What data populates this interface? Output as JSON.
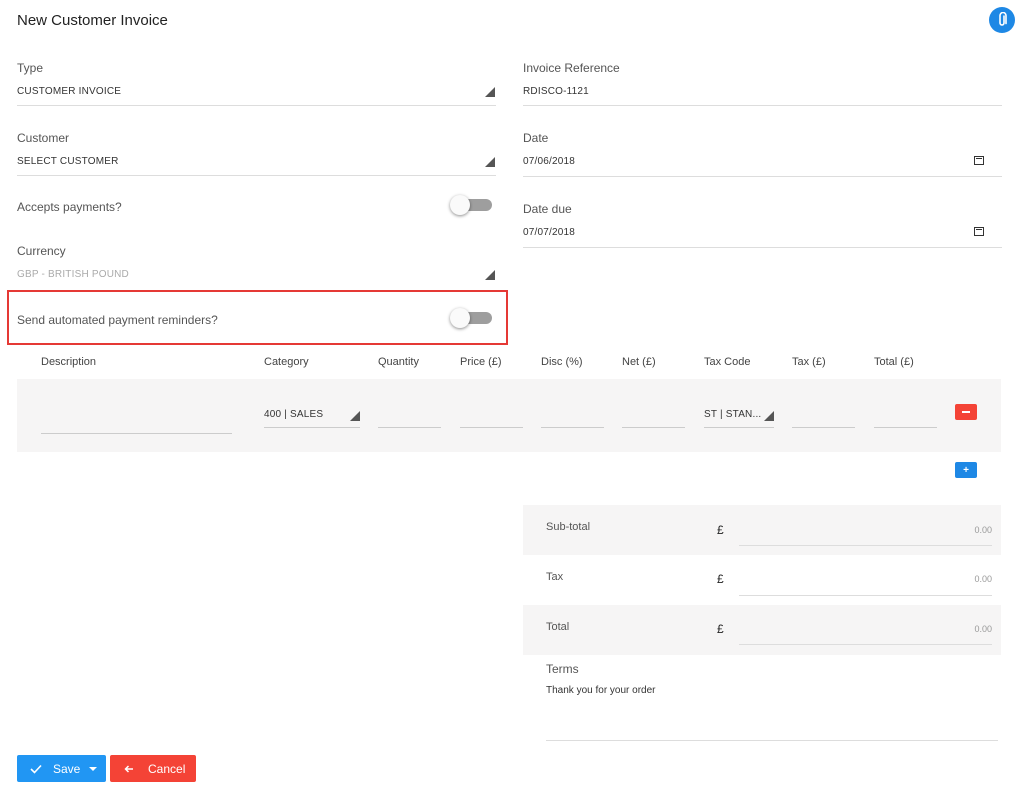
{
  "header": {
    "title": "New Customer Invoice",
    "attach_icon": "paperclip-icon"
  },
  "form": {
    "type": {
      "label": "Type",
      "value": "CUSTOMER INVOICE"
    },
    "customer": {
      "label": "Customer",
      "value": "SELECT CUSTOMER"
    },
    "accepts_payments": {
      "label": "Accepts payments?",
      "on": false
    },
    "currency": {
      "label": "Currency",
      "value": "GBP - BRITISH POUND"
    },
    "reminders": {
      "label": "Send automated payment reminders?",
      "on": false
    },
    "invoice_reference": {
      "label": "Invoice Reference",
      "value": "RDISCO-1121"
    },
    "date": {
      "label": "Date",
      "value": "07/06/2018"
    },
    "date_due": {
      "label": "Date due",
      "value": "07/07/2018"
    }
  },
  "lines": {
    "headers": [
      "Description",
      "Category",
      "Quantity",
      "Price (£)",
      "Disc (%)",
      "Net (£)",
      "Tax Code",
      "Tax (£)",
      "Total (£)"
    ],
    "row": {
      "category": "400 | SALES",
      "tax_code": "ST | STAN..."
    },
    "remove_label": "−",
    "add_label": "+"
  },
  "totals": {
    "subtotal": {
      "label": "Sub-total",
      "currency": "£",
      "value": "0.00"
    },
    "tax": {
      "label": "Tax",
      "currency": "£",
      "value": "0.00"
    },
    "total": {
      "label": "Total",
      "currency": "£",
      "value": "0.00"
    },
    "terms": {
      "label": "Terms",
      "value": "Thank you for your order"
    }
  },
  "actions": {
    "save": {
      "label": "Save",
      "icon": "check-icon"
    },
    "cancel": {
      "label": "Cancel",
      "icon": "arrow-left-icon"
    }
  },
  "colors": {
    "primary": "#2196f3",
    "danger": "#f44336",
    "highlight": "#e53935"
  }
}
